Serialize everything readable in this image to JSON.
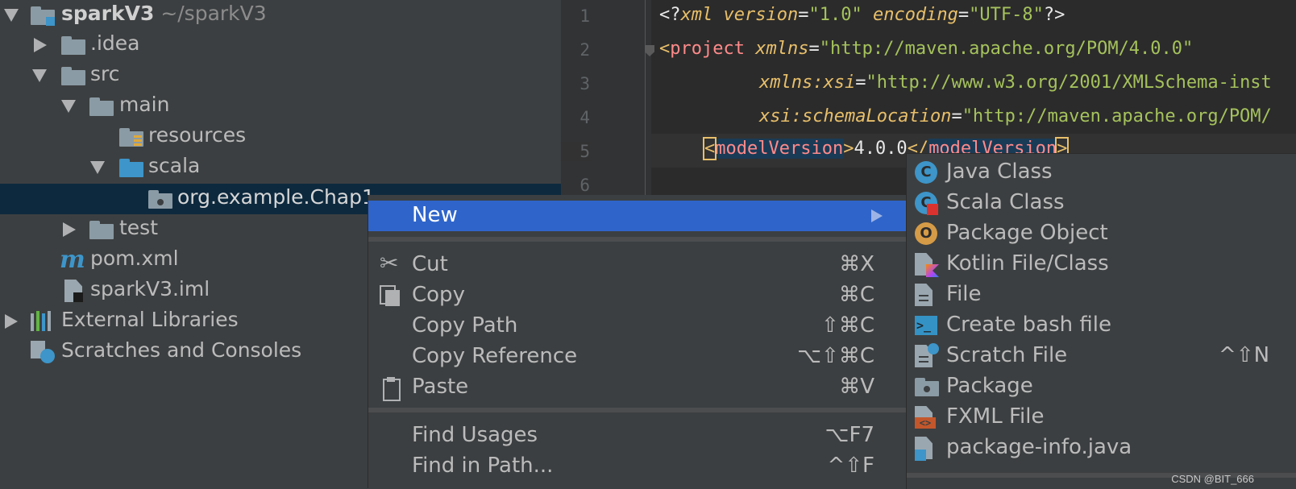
{
  "tree": {
    "project_name": "sparkV3",
    "project_path": "~/sparkV3",
    "items": [
      {
        "label": "sparkV3"
      },
      {
        "label": ".idea"
      },
      {
        "label": "src"
      },
      {
        "label": "main"
      },
      {
        "label": "resources"
      },
      {
        "label": "scala"
      },
      {
        "label": "org.example.Chap1"
      },
      {
        "label": "test"
      },
      {
        "label": "pom.xml"
      },
      {
        "label": "sparkV3.iml"
      },
      {
        "label": "External Libraries"
      },
      {
        "label": "Scratches and Consoles"
      }
    ]
  },
  "editor": {
    "line_numbers": [
      "1",
      "2",
      "3",
      "4",
      "5",
      "6"
    ],
    "line1": {
      "pi_open": "<?",
      "name": "xml",
      "attr1": "version",
      "eq": "=",
      "val1": "\"1.0\"",
      "attr2": "encoding",
      "val2": "\"UTF-8\"",
      "pi_close": "?>"
    },
    "line2": {
      "open": "<",
      "tag": "project",
      "attr": "xmlns",
      "eq": "=",
      "val": "\"http://maven.apache.org/POM/4.0.0\""
    },
    "line3": {
      "prefix": "xmlns",
      "colon": ":",
      "attr": "xsi",
      "eq": "=",
      "val": "\"http://www.w3.org/2001/XMLSchema-inst"
    },
    "line4": {
      "prefix": "xsi",
      "colon": ":",
      "attr": "schemaLocation",
      "eq": "=",
      "val": "\"http://maven.apache.org/POM/"
    },
    "line5": {
      "open": "<",
      "tag": "modelVersion",
      "close": ">",
      "text": "4.0.0",
      "end_open": "</",
      "end_tag": "modelVersion",
      "end_close": ">"
    }
  },
  "context_menu": {
    "items": [
      {
        "label": "New",
        "shortcut": ""
      },
      {
        "label": "Cut",
        "shortcut": "⌘X"
      },
      {
        "label": "Copy",
        "shortcut": "⌘C"
      },
      {
        "label": "Copy Path",
        "shortcut": "⇧⌘C"
      },
      {
        "label": "Copy Reference",
        "shortcut": "⌥⇧⌘C"
      },
      {
        "label": "Paste",
        "shortcut": "⌘V"
      },
      {
        "label": "Find Usages",
        "shortcut": "⌥F7"
      },
      {
        "label": "Find in Path...",
        "shortcut": "^⇧F"
      }
    ]
  },
  "submenu": {
    "items": [
      {
        "label": "Java Class",
        "shortcut": "",
        "icon": "java-class-icon",
        "glyph": "C"
      },
      {
        "label": "Scala Class",
        "shortcut": "",
        "icon": "scala-class-icon",
        "glyph": "C"
      },
      {
        "label": "Package Object",
        "shortcut": "",
        "icon": "package-object-icon",
        "glyph": "O"
      },
      {
        "label": "Kotlin File/Class",
        "shortcut": "",
        "icon": "kotlin-file-icon"
      },
      {
        "label": "File",
        "shortcut": "",
        "icon": "file-icon"
      },
      {
        "label": "Create bash file",
        "shortcut": "",
        "icon": "bash-file-icon",
        "glyph": ">_"
      },
      {
        "label": "Scratch File",
        "shortcut": "^⇧N",
        "icon": "scratch-file-icon"
      },
      {
        "label": "Package",
        "shortcut": "",
        "icon": "package-icon"
      },
      {
        "label": "FXML File",
        "shortcut": "",
        "icon": "fxml-file-icon",
        "glyph": "<>"
      },
      {
        "label": "package-info.java",
        "shortcut": "",
        "icon": "package-info-icon"
      }
    ]
  },
  "colors": {
    "menu_highlight": "#2f65ca",
    "tree_selection": "#0d293e",
    "java_icon": "#3d95c9",
    "scala_icon": "#3d95c9",
    "package_object_icon": "#d59b47"
  },
  "watermark": "CSDN @BIT_666"
}
